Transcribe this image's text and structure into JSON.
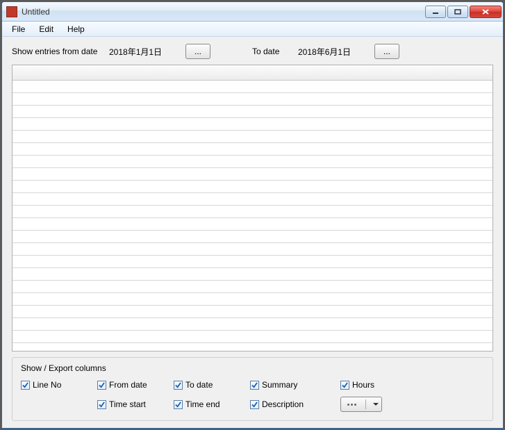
{
  "window": {
    "title": "Untitled"
  },
  "menu": {
    "file": "File",
    "edit": "Edit",
    "help": "Help"
  },
  "filter": {
    "from_label": "Show entries from date",
    "from_value": "2018年1月1日",
    "from_btn": "...",
    "to_label": "To date",
    "to_value": "2018年6月1日",
    "to_btn": "..."
  },
  "columns": {
    "legend": "Show / Export columns",
    "line_no": "Line No",
    "from_date": "From date",
    "to_date": "To date",
    "summary": "Summary",
    "hours": "Hours",
    "time_start": "Time start",
    "time_end": "Time end",
    "description": "Description"
  }
}
